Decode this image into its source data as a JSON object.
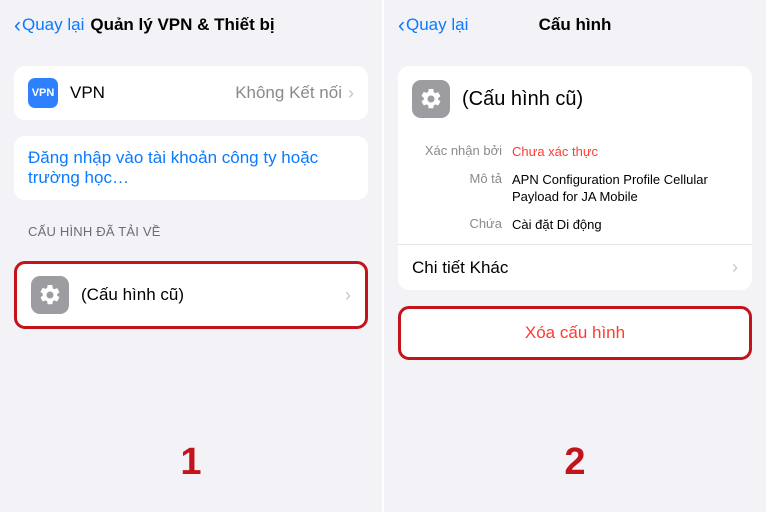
{
  "left": {
    "back": "Quay lại",
    "title": "Quản lý VPN & Thiết bị",
    "vpn_badge": "VPN",
    "vpn_label": "VPN",
    "vpn_status": "Không Kết nối",
    "signin_link": "Đăng nhập vào tài khoản công ty hoặc trường học…",
    "section_downloaded": "CẤU HÌNH ĐÃ TẢI VỀ",
    "profile_name": "(Cấu hình cũ)",
    "step": "1"
  },
  "right": {
    "back": "Quay lại",
    "title": "Cấu hình",
    "profile_name": "(Cấu hình cũ)",
    "verified_by_label": "Xác nhận bởi",
    "verified_by_value": "Chưa xác thực",
    "desc_label": "Mô tả",
    "desc_value": "APN Configuration Profile Cellular Payload for JA Mobile",
    "contains_label": "Chứa",
    "contains_value": "Cài đặt Di động",
    "more_details": "Chi tiết Khác",
    "delete": "Xóa cấu hình",
    "step": "2"
  }
}
